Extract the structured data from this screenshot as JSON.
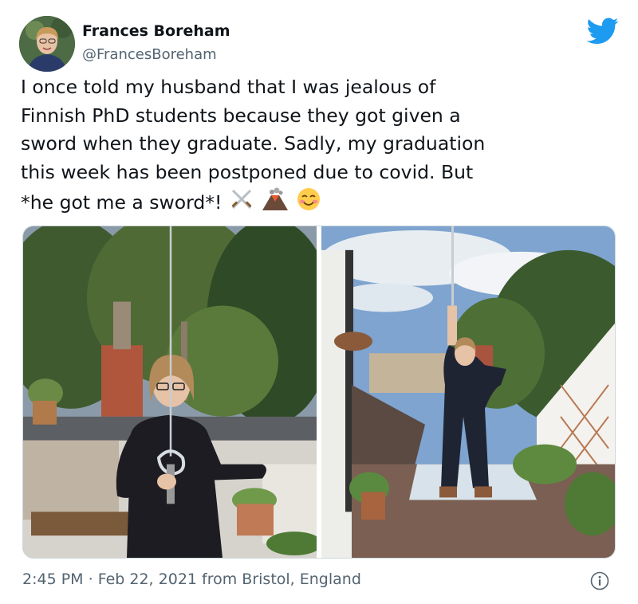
{
  "tweet": {
    "author_name": "Frances Boreham",
    "author_handle": "@FrancesBoreham",
    "text_lines": [
      "I once told my husband that I was jealous of",
      "Finnish PhD students because they got given a",
      "sword when they graduate. Sadly, my graduation",
      "this week has been postponed due to covid. But",
      "*he got me a sword*!"
    ],
    "emojis": [
      "crossed-swords-emoji",
      "volcano-emoji",
      "smiling-face-emoji"
    ],
    "time": "2:45 PM",
    "separator": "·",
    "date": "Feb 22, 2021",
    "location": "from Bristol, England"
  },
  "icons": {
    "brand": "twitter-bird-icon",
    "info": "info-icon"
  },
  "colors": {
    "twitter_blue": "#1d9bf0",
    "text_primary": "#0f1419",
    "text_secondary": "#536471",
    "border": "#cfd9de"
  }
}
